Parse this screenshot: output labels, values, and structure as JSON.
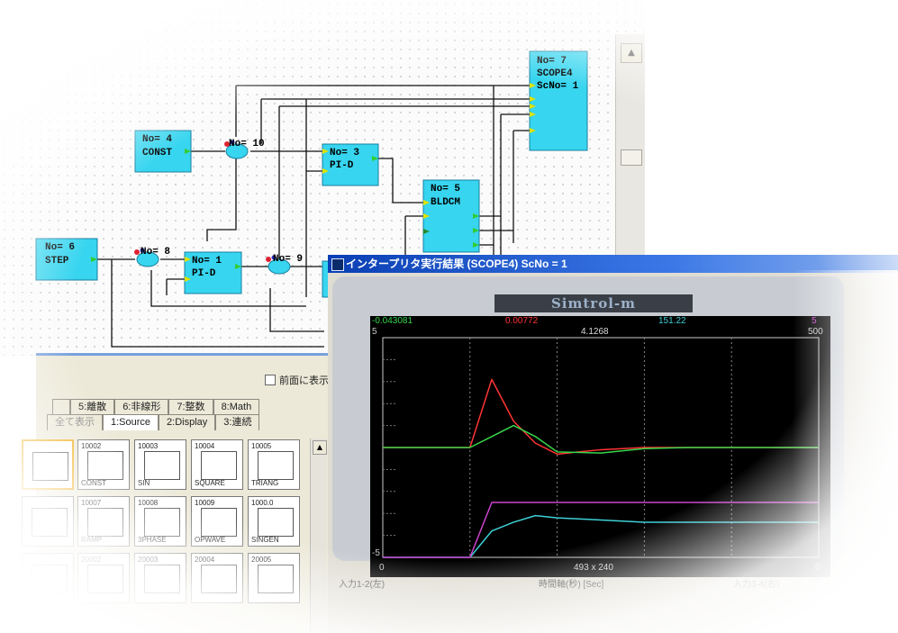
{
  "diagram": {
    "blocks": [
      {
        "id": "scope4",
        "no": "No= 7",
        "name": "SCOPE4",
        "extra": "ScNo= 1"
      },
      {
        "id": "const",
        "no": "No= 4",
        "name": "CONST"
      },
      {
        "id": "pid3",
        "no": "No= 3",
        "name": "PI-D"
      },
      {
        "id": "bldcm",
        "no": "No= 5",
        "name": "BLDCM"
      },
      {
        "id": "step",
        "no": "No= 6",
        "name": "STEP"
      },
      {
        "id": "pid1",
        "no": "No= 1",
        "name": "PI-D"
      }
    ],
    "sum_labels": [
      "No= 10",
      "No= 8",
      "No= 9"
    ]
  },
  "palette": {
    "checkbox_label": "前面に表示",
    "tabs_row1": [
      "5:離散",
      "6:非線形",
      "7:整数",
      "8:Math"
    ],
    "tabs_row2": [
      "全て表示",
      "1:Source",
      "2:Display",
      "3:連続"
    ],
    "items": [
      {
        "num": "",
        "name": ""
      },
      {
        "num": "10002",
        "name": "CONST"
      },
      {
        "num": "10003",
        "name": "SIN"
      },
      {
        "num": "10004",
        "name": "SQUARE"
      },
      {
        "num": "10005",
        "name": "TRIANG"
      },
      {
        "num": "",
        "name": ""
      },
      {
        "num": "10007",
        "name": "RAMP"
      },
      {
        "num": "10008",
        "name": "3PHASE"
      },
      {
        "num": "10009",
        "name": "OPWAVE"
      },
      {
        "num": "1000.0",
        "name": "SINGEN"
      },
      {
        "num": "",
        "name": ""
      },
      {
        "num": "20002",
        "name": ""
      },
      {
        "num": "20003",
        "name": ""
      },
      {
        "num": "20004",
        "name": ""
      },
      {
        "num": "20005",
        "name": ""
      }
    ]
  },
  "result_window": {
    "title": "インタープリタ実行結果 (SCOPE4) ScNo = 1",
    "logo": "Simtrol-m",
    "top_values": {
      "green": "-0.043081",
      "red": "0.00772",
      "white": "4.1268",
      "cyan": "151.22",
      "magenta": "5"
    },
    "axis": {
      "y_top": "5",
      "y_bottom": "-5",
      "x_left_top": "0",
      "x_left_bottom": "0",
      "x_right_top": "500",
      "x_right_bottom": "0",
      "size_label": "493 x 240"
    },
    "footer": [
      "入力1-2(左)",
      "時間軸(秒) [Sec]",
      "入力3-4(右)"
    ]
  },
  "colors": {
    "block_fill": "#37d5ef",
    "wire": "#111111",
    "red": "#ff3434",
    "green": "#36d54a",
    "cyan": "#3ecfd6",
    "magenta": "#cc44cc"
  },
  "chart_data": {
    "type": "line",
    "x": [
      0,
      25,
      50,
      75,
      100,
      125,
      150,
      175,
      200,
      250,
      300,
      350,
      400,
      450,
      500
    ],
    "ylim": [
      -5,
      5
    ],
    "xlim": [
      0,
      500
    ],
    "series": [
      {
        "values": [
          0,
          0,
          0,
          0,
          0,
          3.1,
          1.2,
          0.2,
          -0.3,
          -0.1,
          0,
          0,
          0,
          0,
          0
        ]
      },
      {
        "values": [
          0,
          0,
          0,
          0,
          0,
          0.5,
          1.0,
          0.5,
          -0.2,
          -0.25,
          -0.05,
          0,
          0,
          0,
          0
        ]
      },
      {
        "values": [
          -5,
          -5,
          -5,
          -5,
          -5,
          -3.8,
          -3.4,
          -3.1,
          -3.2,
          -3.3,
          -3.4,
          -3.4,
          -3.4,
          -3.4,
          -3.4
        ]
      },
      {
        "values": [
          -5,
          -5,
          -5,
          -5,
          -5,
          -2.5,
          -2.5,
          -2.5,
          -2.5,
          -2.5,
          -2.5,
          -2.5,
          -2.5,
          -2.5,
          -2.5
        ]
      }
    ],
    "grid": true
  }
}
